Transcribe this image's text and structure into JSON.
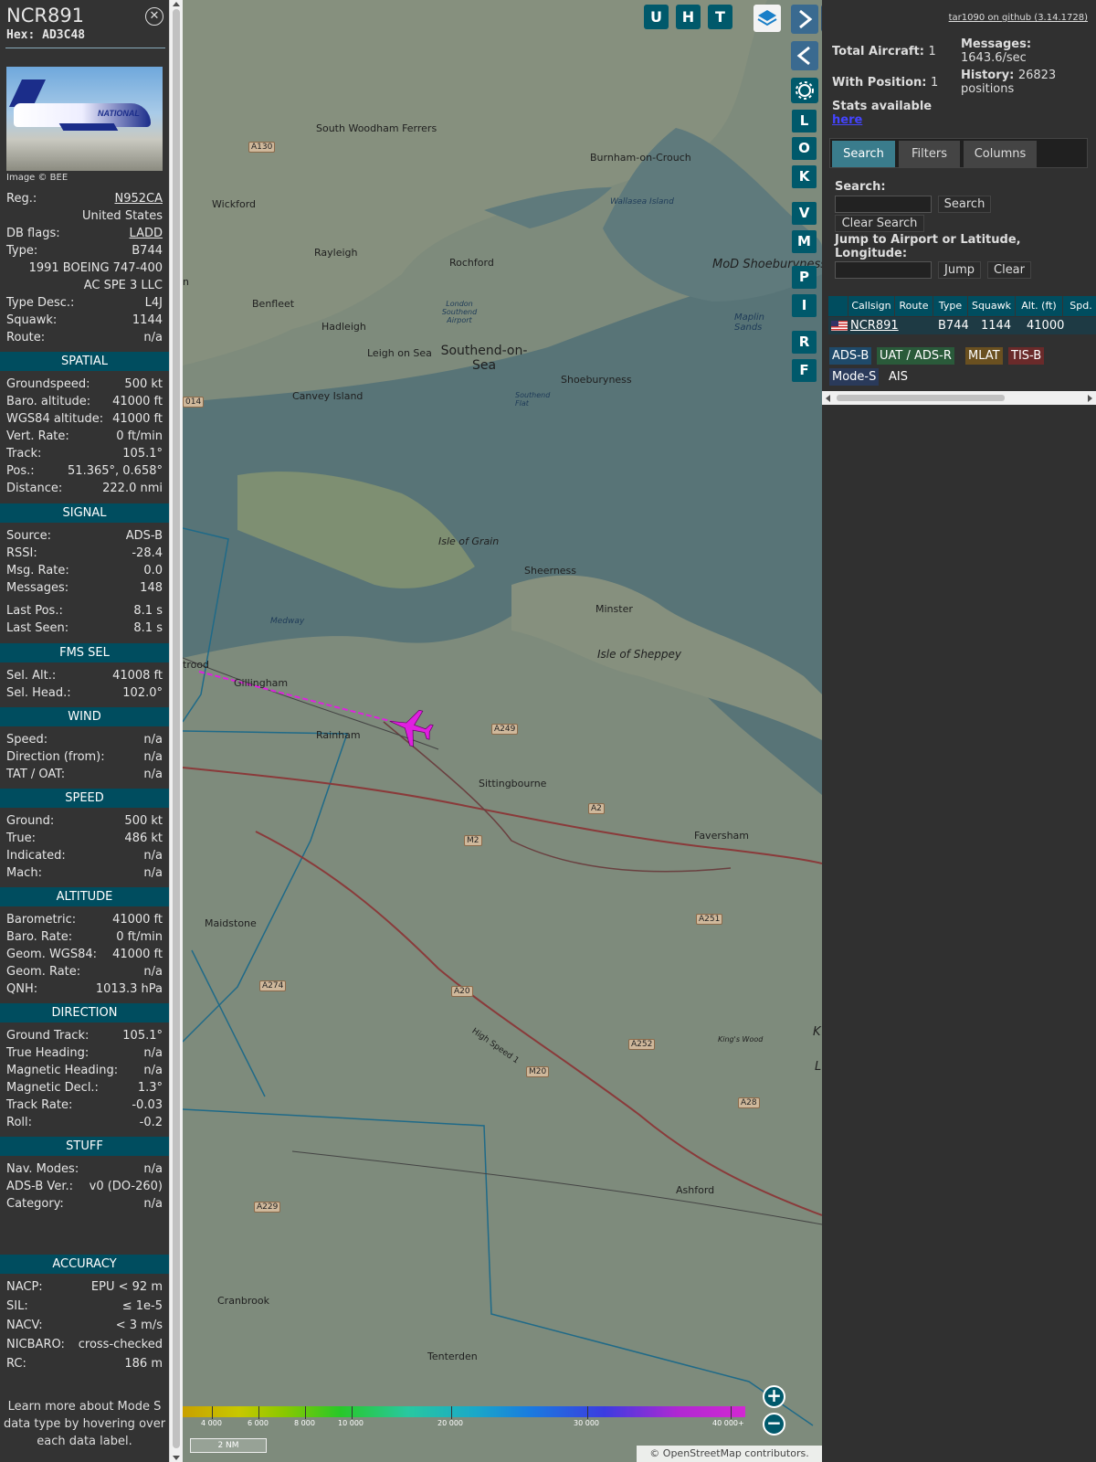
{
  "sidebar": {
    "callsign": "NCR891",
    "hex": "Hex: AD3C48",
    "photo_credit": "Image © BEE",
    "photo_text": "NATIONAL",
    "info": [
      {
        "k": "Reg.:",
        "v": "N952CA",
        "link": true
      },
      {
        "k": "",
        "v": "United States"
      },
      {
        "k": "DB flags:",
        "v": "LADD",
        "link": true
      },
      {
        "k": "Type:",
        "v": "B744"
      },
      {
        "k": "",
        "v": "1991 BOEING 747-400"
      },
      {
        "k": "",
        "v": "AC SPE 3 LLC"
      },
      {
        "k": "Type Desc.:",
        "v": "L4J"
      },
      {
        "k": "Squawk:",
        "v": "1144"
      },
      {
        "k": "Route:",
        "v": "n/a"
      }
    ],
    "sections": [
      {
        "title": "SPATIAL",
        "rows": [
          {
            "k": "Groundspeed:",
            "v": "500 kt"
          },
          {
            "k": "Baro. altitude:",
            "v": "41000 ft"
          },
          {
            "k": "WGS84 altitude:",
            "v": "41000 ft"
          },
          {
            "k": "Vert. Rate:",
            "v": "0 ft/min"
          },
          {
            "k": "Track:",
            "v": "105.1°"
          },
          {
            "k": "Pos.:",
            "v": "51.365°, 0.658°"
          },
          {
            "k": "Distance:",
            "v": "222.0 nmi"
          }
        ]
      },
      {
        "title": "SIGNAL",
        "rows": [
          {
            "k": "Source:",
            "v": "ADS-B"
          },
          {
            "k": "RSSI:",
            "v": "-28.4"
          },
          {
            "k": "Msg. Rate:",
            "v": "0.0"
          },
          {
            "k": "Messages:",
            "v": "148"
          },
          {
            "k": "Last Pos.:",
            "v": "8.1 s"
          },
          {
            "k": "Last Seen:",
            "v": "8.1 s"
          }
        ]
      },
      {
        "title": "FMS SEL",
        "rows": [
          {
            "k": "Sel. Alt.:",
            "v": "41008 ft"
          },
          {
            "k": "Sel. Head.:",
            "v": "102.0°"
          }
        ]
      },
      {
        "title": "WIND",
        "rows": [
          {
            "k": "Speed:",
            "v": "n/a"
          },
          {
            "k": "Direction (from):",
            "v": "n/a"
          },
          {
            "k": "TAT / OAT:",
            "v": "n/a"
          }
        ]
      },
      {
        "title": "SPEED",
        "rows": [
          {
            "k": "Ground:",
            "v": "500 kt"
          },
          {
            "k": "True:",
            "v": "486 kt"
          },
          {
            "k": "Indicated:",
            "v": "n/a"
          },
          {
            "k": "Mach:",
            "v": "n/a"
          }
        ]
      },
      {
        "title": "ALTITUDE",
        "rows": [
          {
            "k": "Barometric:",
            "v": "41000 ft"
          },
          {
            "k": "Baro. Rate:",
            "v": "0 ft/min"
          },
          {
            "k": "Geom. WGS84:",
            "v": "41000 ft"
          },
          {
            "k": "Geom. Rate:",
            "v": "n/a"
          },
          {
            "k": "QNH:",
            "v": "1013.3 hPa"
          }
        ]
      },
      {
        "title": "DIRECTION",
        "rows": [
          {
            "k": "Ground Track:",
            "v": "105.1°"
          },
          {
            "k": "True Heading:",
            "v": "n/a"
          },
          {
            "k": "Magnetic Heading:",
            "v": "n/a"
          },
          {
            "k": "Magnetic Decl.:",
            "v": "1.3°"
          },
          {
            "k": "Track Rate:",
            "v": "-0.03"
          },
          {
            "k": "Roll:",
            "v": "-0.2"
          }
        ]
      },
      {
        "title": "STUFF",
        "rows": [
          {
            "k": "Nav. Modes:",
            "v": "n/a"
          },
          {
            "k": "ADS-B Ver.:",
            "v": "v0 (DO-260)"
          },
          {
            "k": "Category:",
            "v": "n/a"
          }
        ]
      },
      {
        "title": "ACCURACY",
        "rows": [
          {
            "k": "NACP:",
            "v": "EPU < 92 m"
          },
          {
            "k": "SIL:",
            "v": "≤ 1e-5"
          },
          {
            "k": "NACV:",
            "v": "< 3 m/s"
          },
          {
            "k": "NICBARO:",
            "v": "cross-checked"
          },
          {
            "k": "RC:",
            "v": "186 m"
          }
        ]
      }
    ],
    "learn_more": "Learn more about Mode S data type by hovering over each data label."
  },
  "map": {
    "top_buttons": [
      "U",
      "H",
      "T"
    ],
    "side_buttons": [
      "L",
      "O",
      "K",
      "V",
      "M",
      "P",
      "I",
      "R",
      "F"
    ],
    "zoom_in": "+",
    "zoom_out": "−",
    "color_scale": [
      "4 000",
      "6 000",
      "8 000",
      "10 000",
      "20 000",
      "30 000",
      "40 000+"
    ],
    "scale_bar": "2 NM",
    "attribution": "© OpenStreetMap contributors.",
    "places": [
      "South Woodham Ferrers",
      "Burnham-on-Crouch",
      "Wickford",
      "Wallasea Island",
      "Rayleigh",
      "Rochford",
      "MoD Shoeburyness",
      "London Southend Airport",
      "Benfleet",
      "Hadleigh",
      "Southend-on-Sea",
      "Leigh on Sea",
      "Shoeburyness",
      "Maplin Sands",
      "Canvey Island",
      "Southend Flat",
      "Isle of Grain",
      "Sheerness",
      "Minster",
      "Isle of Sheppey",
      "Medway",
      "Gillingham",
      "Rainham",
      "Sittingbourne",
      "Faversham",
      "Maidstone",
      "King's Wood",
      "Ashford",
      "Cranbrook",
      "Tenterden",
      "High Speed 1",
      "trood",
      "n",
      "K",
      "L"
    ],
    "roads": [
      "A130",
      "A249",
      "A2",
      "M2",
      "A251",
      "A274",
      "A20",
      "A252",
      "M20",
      "A28",
      "A229",
      "014"
    ],
    "aircraft_color": "#e020e0"
  },
  "panel": {
    "github": "tar1090 on github (3.14.1728)",
    "total_label": "Total Aircraft:",
    "total": "1",
    "withpos_label": "With Position:",
    "withpos": "1",
    "messages_label": "Messages:",
    "messages": "1643.6/sec",
    "history_label": "History:",
    "history": "26823 positions",
    "stats_label": "Stats available",
    "stats_link": "here",
    "tabs": [
      "Search",
      "Filters",
      "Columns"
    ],
    "search_label": "Search:",
    "search_btn": "Search",
    "clear_search": "Clear Search",
    "jump_label": "Jump to Airport or Latitude, Longitude:",
    "jump_btn": "Jump",
    "clear_btn": "Clear",
    "columns": [
      "Callsign",
      "Route",
      "Type",
      "Squawk",
      "Alt. (ft)",
      "Spd."
    ],
    "row": {
      "callsign": "NCR891",
      "route": "",
      "type": "B744",
      "squawk": "1144",
      "alt": "41000"
    },
    "sources": [
      {
        "label": "ADS-B",
        "color": "#1f4a6a"
      },
      {
        "label": "UAT / ADS-R",
        "color": "#2a5a3a"
      },
      {
        "label": "MLAT",
        "color": "#6a5020"
      },
      {
        "label": "TIS-B",
        "color": "#6a2a2a"
      },
      {
        "label": "Mode-S",
        "color": "#2a3a5a"
      },
      {
        "label": "AIS",
        "color": "transparent"
      }
    ]
  }
}
